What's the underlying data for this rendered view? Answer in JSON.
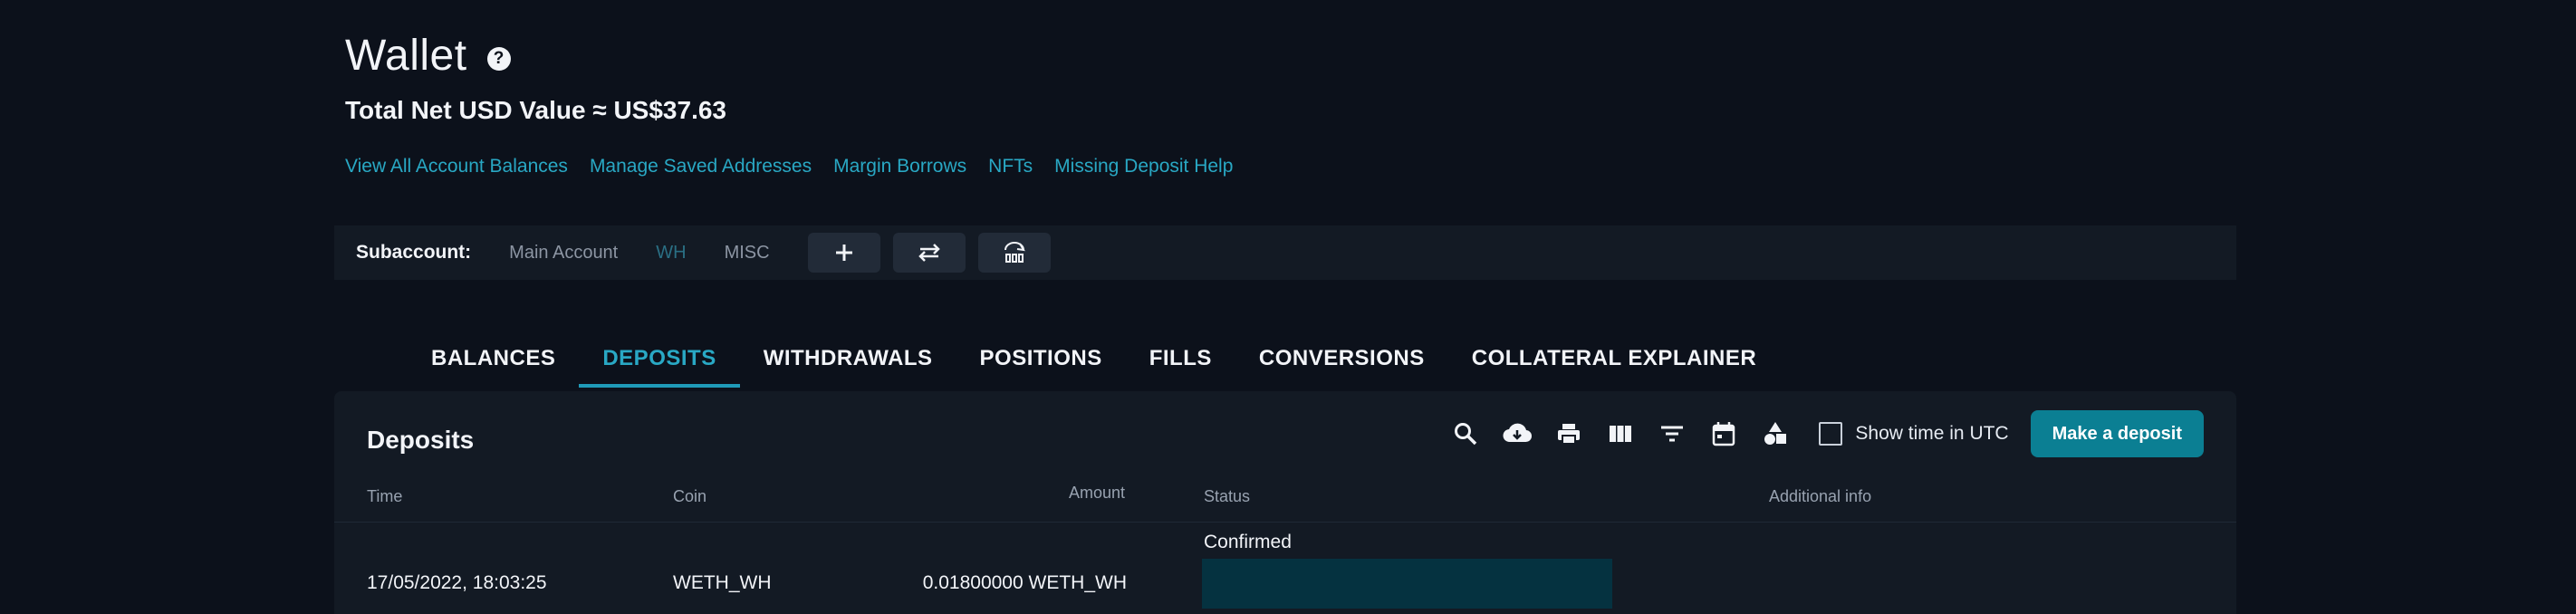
{
  "header": {
    "title": "Wallet",
    "help_glyph": "?",
    "net_value": "Total Net USD Value ≈ US$37.63"
  },
  "links": [
    "View All Account Balances",
    "Manage Saved Addresses",
    "Margin Borrows",
    "NFTs",
    "Missing Deposit Help"
  ],
  "subaccount": {
    "label": "Subaccount:",
    "options": [
      "Main Account",
      "WH",
      "MISC"
    ],
    "selected": "WH",
    "buttons": [
      "plus-icon",
      "transfer-icon",
      "bank-icon"
    ]
  },
  "tabs": [
    "BALANCES",
    "DEPOSITS",
    "WITHDRAWALS",
    "POSITIONS",
    "FILLS",
    "CONVERSIONS",
    "COLLATERAL EXPLAINER"
  ],
  "active_tab": "DEPOSITS",
  "deposits": {
    "title": "Deposits",
    "toolbar_icons": [
      "search-icon",
      "download-icon",
      "print-icon",
      "columns-icon",
      "filter-icon",
      "calendar-icon",
      "shapes-icon"
    ],
    "utc_label": "Show time in UTC",
    "utc_checked": false,
    "deposit_button": "Make a deposit",
    "columns": [
      "Time",
      "Coin",
      "Amount",
      "Status",
      "Additional info"
    ],
    "rows": [
      {
        "time": "17/05/2022, 18:03:25",
        "coin": "WETH_WH",
        "amount": "0.01800000 WETH_WH",
        "status": "Confirmed",
        "additional_info": ""
      }
    ]
  },
  "colors": {
    "background": "#0c111b",
    "panel": "#131a24",
    "accent": "#29a8c4",
    "button": "#0b7f93",
    "redacted": "#053240"
  }
}
